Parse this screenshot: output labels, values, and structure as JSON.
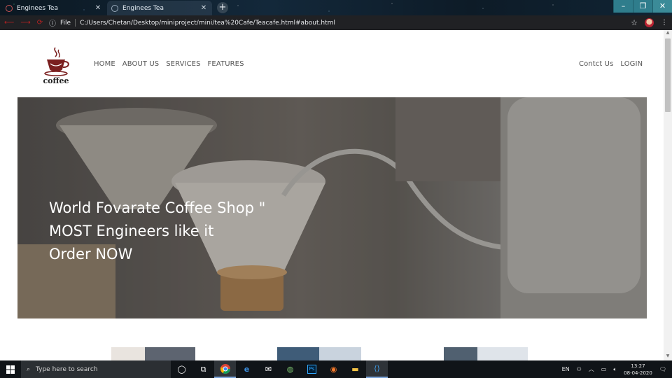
{
  "browser": {
    "tabs": [
      {
        "title": "Enginees Tea",
        "active": false
      },
      {
        "title": "Enginees Tea",
        "active": true
      }
    ],
    "new_tab": "+",
    "window_buttons": {
      "minimize": "–",
      "maximize": "❐",
      "close": "✕"
    },
    "address": {
      "scheme_label": "File",
      "url": "C:/Users/Chetan/Desktop/miniproject/mini/tea%20Cafe/Teacafe.html#about.html"
    }
  },
  "site": {
    "logo_text": "coffee",
    "nav_left": [
      "HOME",
      "ABOUT US",
      "SERVICES",
      "FEATURES"
    ],
    "nav_right": [
      "Contct Us",
      "LOGIN"
    ],
    "hero_lines": [
      "World Fovarate Coffee Shop \"",
      "MOST Engineers like it",
      "Order NOW"
    ]
  },
  "taskbar": {
    "search_placeholder": "Type here to search",
    "language": "EN",
    "time": "13:27",
    "date": "08-04-2020"
  },
  "colors": {
    "accent_logo": "#7a1f1f",
    "nav_text": "#555555",
    "taskbar_bg": "#101418"
  }
}
